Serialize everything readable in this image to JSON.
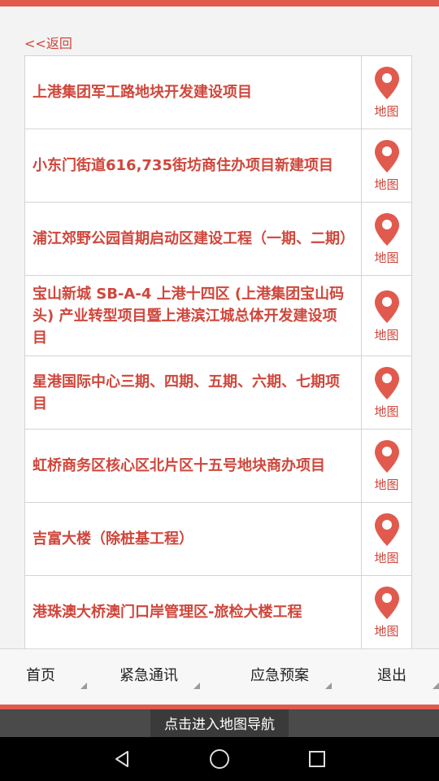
{
  "header": {
    "back_label": "<<返回"
  },
  "list": {
    "items": [
      {
        "title": "上港集团军工路地块开发建设项目",
        "map_label": "地图"
      },
      {
        "title": "小东门街道616,735街坊商住办项目新建项目",
        "map_label": "地图"
      },
      {
        "title": "浦江郊野公园首期启动区建设工程（一期、二期）",
        "map_label": "地图"
      },
      {
        "title": "宝山新城 SB-A-4 上港十四区 (上港集团宝山码头) 产业转型项目暨上港滨江城总体开发建设项目",
        "map_label": "地图"
      },
      {
        "title": "星港国际中心三期、四期、五期、六期、七期项目",
        "map_label": "地图"
      },
      {
        "title": "虹桥商务区核心区北片区十五号地块商办项目",
        "map_label": "地图"
      },
      {
        "title": "吉富大楼（除桩基工程）",
        "map_label": "地图"
      },
      {
        "title": "港珠澳大桥澳门口岸管理区-旅检大楼工程",
        "map_label": "地图"
      }
    ]
  },
  "bottom_nav": {
    "home": "首页",
    "emergency_contacts": "紧急通讯",
    "emergency_plans": "应急预案",
    "logout": "退出"
  },
  "toast": {
    "text": "点击进入地图导航"
  },
  "colors": {
    "accent": "#e05a4e",
    "text_red": "#d0463b"
  }
}
